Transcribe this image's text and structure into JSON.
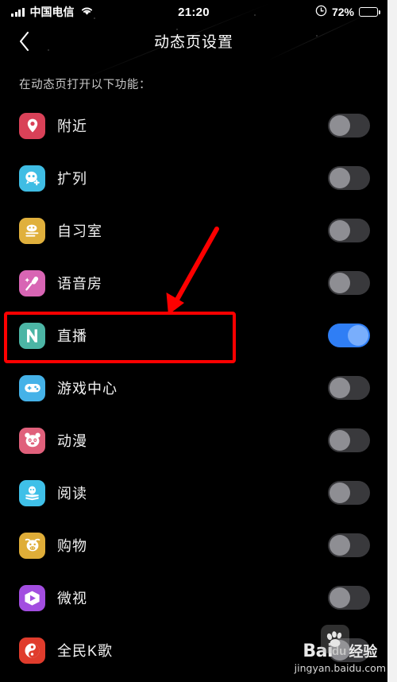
{
  "status_bar": {
    "carrier": "中国电信",
    "time": "21:20",
    "battery_percent": "72%",
    "battery_level": 72,
    "signal_icon": "signal-bars-icon",
    "wifi_icon": "wifi-icon",
    "alarm_icon": "alarm-clock-icon",
    "battery_icon": "battery-icon"
  },
  "nav": {
    "title": "动态页设置",
    "back_icon": "chevron-left-icon"
  },
  "content": {
    "section_header": "在动态页打开以下功能："
  },
  "features": [
    {
      "label": "附近",
      "icon": "location-pin-icon",
      "icon_bg": "#d94158",
      "enabled": false
    },
    {
      "label": "扩列",
      "icon": "add-friend-icon",
      "icon_bg": "#3fbde4",
      "enabled": false
    },
    {
      "label": "自习室",
      "icon": "study-room-icon",
      "icon_bg": "#e0b03c",
      "enabled": false
    },
    {
      "label": "语音房",
      "icon": "microphone-icon",
      "icon_bg": "#d865b4",
      "enabled": false
    },
    {
      "label": "直播",
      "icon": "live-stream-icon",
      "icon_bg": "#4cb5a5",
      "enabled": true
    },
    {
      "label": "游戏中心",
      "icon": "gamepad-icon",
      "icon_bg": "#45b2e8",
      "enabled": false
    },
    {
      "label": "动漫",
      "icon": "panda-icon",
      "icon_bg": "#e0607b",
      "enabled": false
    },
    {
      "label": "阅读",
      "icon": "penguin-book-icon",
      "icon_bg": "#3fc0e8",
      "enabled": false
    },
    {
      "label": "购物",
      "icon": "cow-icon",
      "icon_bg": "#dfad38",
      "enabled": false
    },
    {
      "label": "微视",
      "icon": "weishi-play-icon",
      "icon_bg": "#a24de0",
      "enabled": false
    },
    {
      "label": "全民K歌",
      "icon": "karaoke-icon",
      "icon_bg": "#e03c2c",
      "enabled": false
    }
  ],
  "annotations": {
    "highlight_target": "直播",
    "highlight_color": "#fe0000",
    "arrow_color": "#fe0000",
    "arrow_icon": "red-arrow-annotation"
  },
  "watermark": {
    "brand_bai": "Bai",
    "brand_du": "du",
    "brand_suffix": "经验",
    "url": "jingyan.baidu.com",
    "paw_icon": "baidu-paw-icon"
  },
  "colors": {
    "background": "#000000",
    "toggle_on": "#2f7ef5",
    "toggle_on_knob": "#79aefc",
    "toggle_off_track": "#39393c",
    "toggle_off_knob": "#8e8e93",
    "text_primary": "#f2f2f2",
    "text_secondary": "#c9c9c9",
    "annotation_red": "#fe0000"
  }
}
